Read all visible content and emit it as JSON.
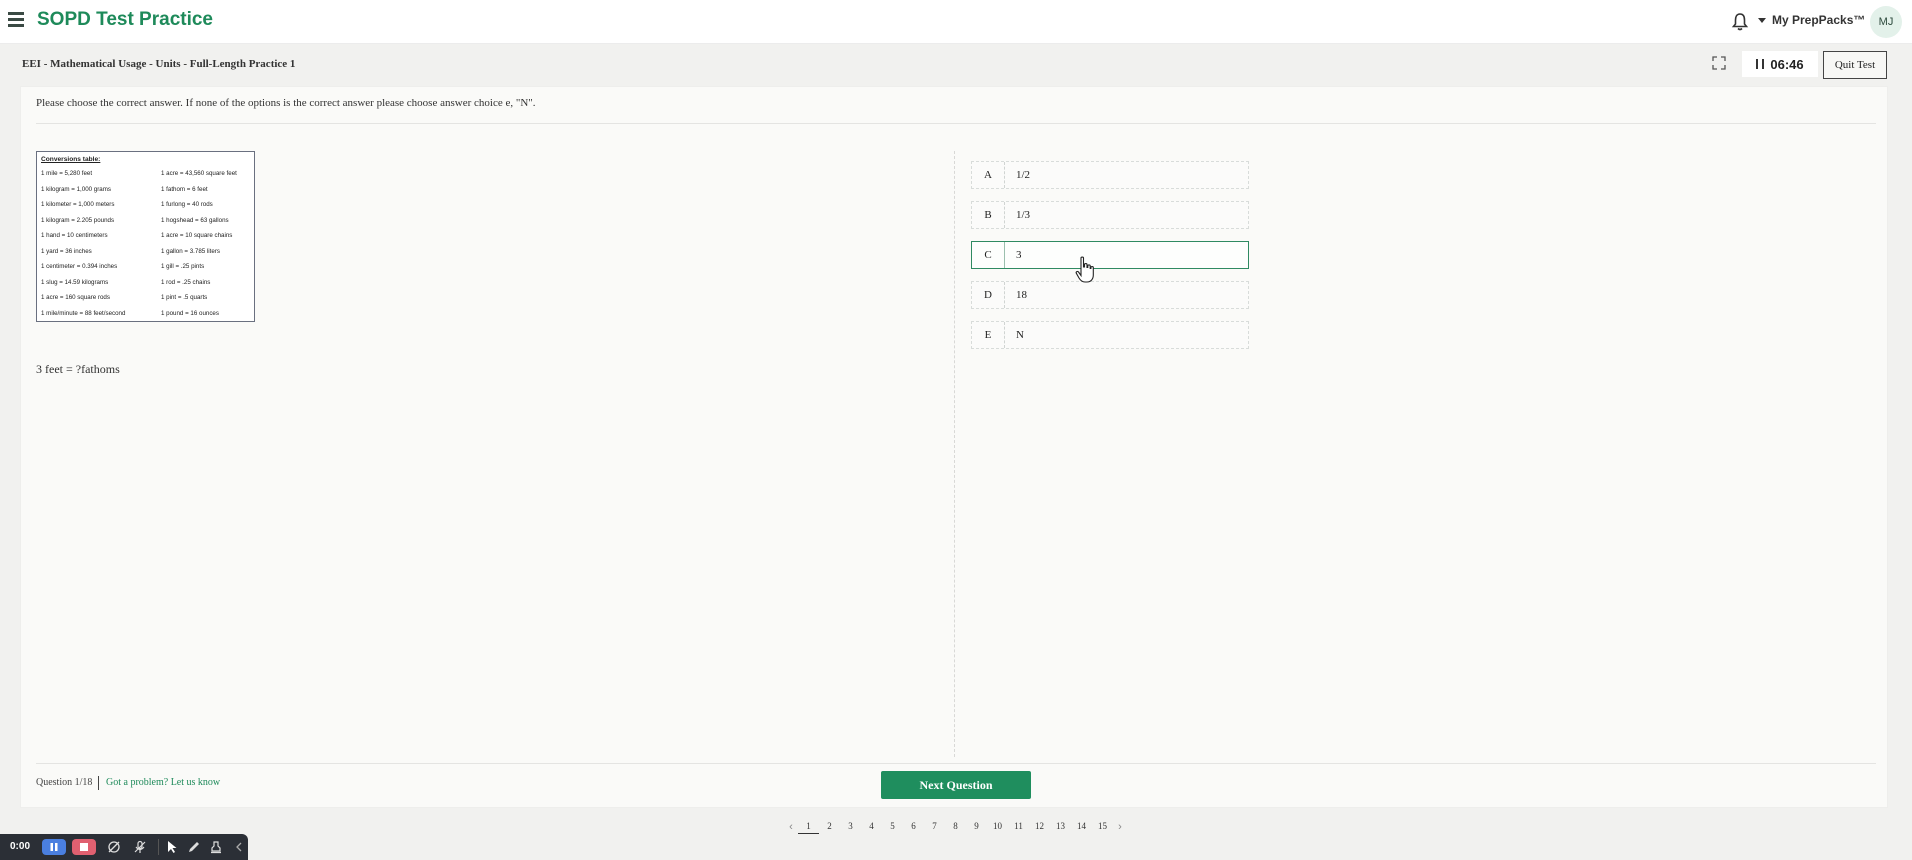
{
  "header": {
    "brand": "SOPD Test Practice",
    "menu_icon": "hamburger-icon",
    "notification_icon": "bell-icon",
    "my_prep_packs": "My PrepPacks™",
    "avatar_initials": "MJ"
  },
  "test_bar": {
    "breadcrumb": "EEI - Mathematical Usage  - Units - Full-Length Practice 1",
    "fullscreen_icon": "expand-icon",
    "timer": "06:46",
    "quit_label": "Quit Test"
  },
  "question": {
    "instruction": "Please choose the correct answer. If none of the options is the correct answer please choose answer choice e, \"N\".",
    "conversion_table": {
      "title": "Conversions table:",
      "rows": [
        [
          "1 mile = 5,280 feet",
          "1 acre = 43,560 square feet"
        ],
        [
          "1 kilogram = 1,000 grams",
          "1 fathom = 6 feet"
        ],
        [
          "1 kilometer = 1,000 meters",
          "1 furlong = 40 rods"
        ],
        [
          "1 kilogram = 2.205 pounds",
          "1 hogshead = 63 gallons"
        ],
        [
          "1 hand = 10 centimeters",
          "1 acre = 10 square chains"
        ],
        [
          "1 yard = 36 inches",
          "1 gallon = 3.785 liters"
        ],
        [
          "1 centimeter = 0.394 inches",
          "1 gill = .25 pints"
        ],
        [
          "1 slug = 14.59 kilograms",
          "1 rod = .25 chains"
        ],
        [
          "1 acre = 160 square rods",
          "1 pint = .5 quarts"
        ],
        [
          "1 mile/minute = 88 feet/second",
          "1 pound = 16 ounces"
        ]
      ]
    },
    "prompt": "3 feet = ?fathoms",
    "options": [
      {
        "letter": "A",
        "value": "1/2"
      },
      {
        "letter": "B",
        "value": "1/3"
      },
      {
        "letter": "C",
        "value": "3"
      },
      {
        "letter": "D",
        "value": "18"
      },
      {
        "letter": "E",
        "value": "N"
      }
    ],
    "selected": "C"
  },
  "footer": {
    "question_counter": "Question 1/18",
    "problem_link": "Got a problem? Let us know",
    "next_label": "Next Question"
  },
  "pagination": {
    "pages": [
      "1",
      "2",
      "3",
      "4",
      "5",
      "6",
      "7",
      "8",
      "9",
      "10",
      "11",
      "12",
      "13",
      "14",
      "15"
    ],
    "current": "1"
  },
  "recorder": {
    "time": "0:00"
  }
}
